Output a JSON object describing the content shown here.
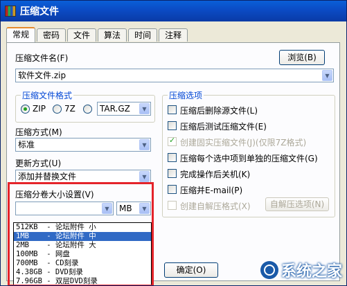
{
  "window": {
    "title": "压缩文件"
  },
  "tabs": [
    {
      "label": "常规",
      "active": true
    },
    {
      "label": "密码"
    },
    {
      "label": "文件"
    },
    {
      "label": "算法"
    },
    {
      "label": "时间"
    },
    {
      "label": "注释"
    }
  ],
  "archive": {
    "label": "压缩文件名(F)",
    "browse_label": "浏览(B)",
    "value": "软件文件.zip"
  },
  "format": {
    "title": "压缩文件格式",
    "options": [
      "ZIP",
      "7Z",
      "TAR.GZ"
    ],
    "selected": "ZIP"
  },
  "method": {
    "label": "压缩方式(M)",
    "value": "标准"
  },
  "update": {
    "label": "更新方式(U)",
    "value": "添加并替换文件"
  },
  "split": {
    "label": "压缩分卷大小设置(V)",
    "value": "",
    "unit": "MB",
    "dropdown_items": [
      "512KB  - 论坛附件 小",
      "1MB    - 论坛附件 中",
      "2MB    - 论坛附件 大",
      "100MB  - 网盘",
      "700MB  - CD刻录",
      "4.38GB - DVD刻录",
      "7.96GB - 双层DVD刻录"
    ],
    "selected_index": 1
  },
  "options": {
    "title": "压缩选项",
    "items": [
      {
        "label": "压缩后删除源文件(L)",
        "checked": false,
        "disabled": false
      },
      {
        "label": "压缩后测试压缩文件(E)",
        "checked": false,
        "disabled": false
      },
      {
        "label": "创建固实压缩文件(J)(仅限7Z格式)",
        "checked": true,
        "disabled": true
      },
      {
        "label": "压缩每个选中项到单独的压缩文件(G)",
        "checked": false,
        "disabled": false
      },
      {
        "label": "完成操作后关机(K)",
        "checked": false,
        "disabled": false
      },
      {
        "label": "压缩并E-mail(P)",
        "checked": false,
        "disabled": false
      },
      {
        "label": "创建自解压格式(X)",
        "checked": false,
        "disabled": true
      }
    ],
    "sfx_button": "自解压选项(N)"
  },
  "ok_label": "确定(O)",
  "watermark": "系统之家",
  "colors": {
    "highlight": "#e4232a",
    "selection": "#316ac5",
    "title_bar": "#0b4bc4"
  }
}
